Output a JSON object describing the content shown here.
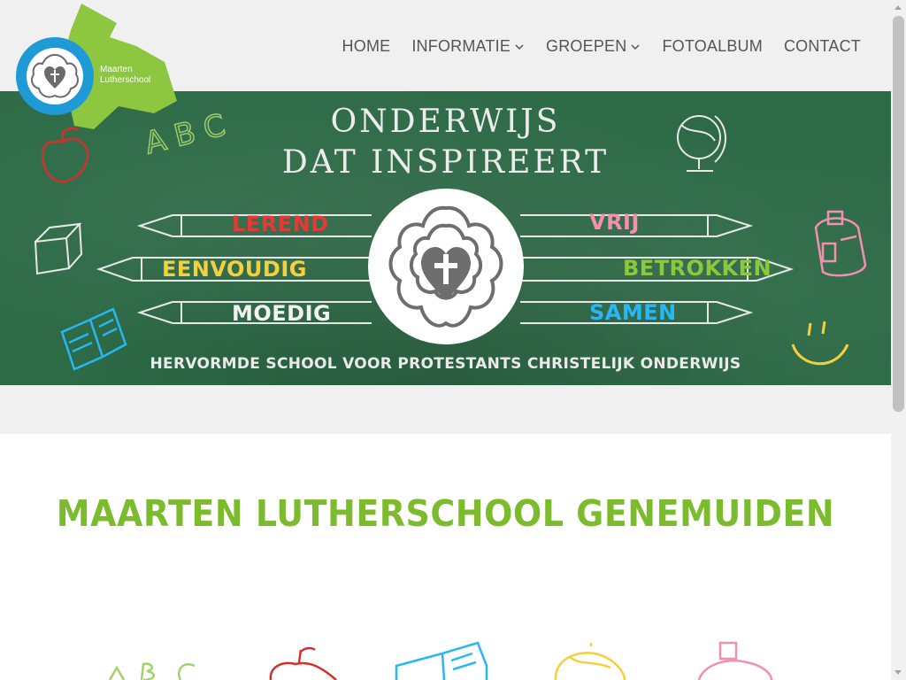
{
  "logo": {
    "line1": "Maarten",
    "line2": "Lutherschool",
    "icon": "luther-rose-icon",
    "colors": {
      "circle": "#1e9ad6",
      "shape": "#8dc63f"
    }
  },
  "nav": {
    "items": [
      {
        "label": "HOME",
        "dropdown": false
      },
      {
        "label": "INFORMATIE",
        "dropdown": true
      },
      {
        "label": "GROEPEN",
        "dropdown": true
      },
      {
        "label": "FOTOALBUM",
        "dropdown": false
      },
      {
        "label": "CONTACT",
        "dropdown": false
      }
    ],
    "color": "#555555"
  },
  "banner": {
    "title_line1": "ONDERWIJS",
    "title_line2": "DAT INSPIREERT",
    "left_words": [
      {
        "text": "LEREND",
        "color": "#e53935"
      },
      {
        "text": "EENVOUDIG",
        "color": "#f4d03f"
      },
      {
        "text": "MOEDIG",
        "color": "#f2f2f2"
      }
    ],
    "right_words": [
      {
        "text": "VRIJ",
        "color": "#f48fb1"
      },
      {
        "text": "BETROKKEN",
        "color": "#8dc63f"
      },
      {
        "text": "SAMEN",
        "color": "#29b6f6"
      }
    ],
    "footer": "HERVORMDE SCHOOL VOOR PROTESTANTS CHRISTELIJK ONDERWIJS",
    "doodle_abc": "A B C",
    "doodle_icons": [
      "apple-icon",
      "abc-icon",
      "globe-icon",
      "cube-icon",
      "backpack-icon",
      "book-icon",
      "smiley-icon"
    ],
    "background": "#2d6a46"
  },
  "main": {
    "title": "MAARTEN LUTHERSCHOOL GENEMUIDEN",
    "title_color": "#7dbb2e",
    "doodles": [
      "abc-icon",
      "apple-icon",
      "book-icon",
      "globe-icon",
      "backpack-icon"
    ]
  }
}
